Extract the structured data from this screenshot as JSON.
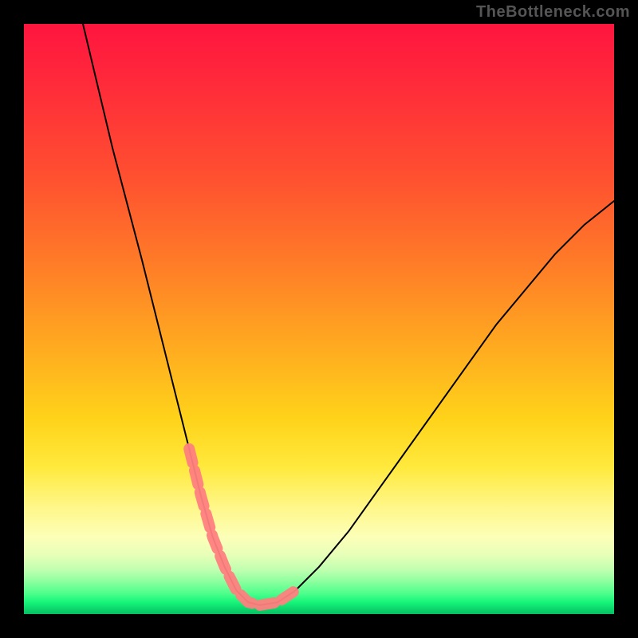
{
  "attribution": "TheBottleneck.com",
  "chart_data": {
    "type": "line",
    "title": "",
    "xlabel": "",
    "ylabel": "",
    "xlim": [
      0,
      100
    ],
    "ylim": [
      0,
      100
    ],
    "grid": false,
    "legend": false,
    "background_gradient": {
      "stops": [
        {
          "pos": 0.0,
          "color": "#ff153f"
        },
        {
          "pos": 0.5,
          "color": "#ffa820"
        },
        {
          "pos": 0.75,
          "color": "#ffe93c"
        },
        {
          "pos": 0.9,
          "color": "#e7ffb8"
        },
        {
          "pos": 1.0,
          "color": "#07c062"
        }
      ]
    },
    "curve": {
      "comment": "Black V-shaped bottleneck curve. y = percentage height from bottom (0=bottom, 100=top).",
      "x": [
        10,
        15,
        20,
        25,
        28,
        30,
        32,
        34,
        36,
        38,
        40,
        43,
        46,
        50,
        55,
        60,
        65,
        70,
        75,
        80,
        85,
        90,
        95,
        100
      ],
      "y": [
        100,
        79,
        60,
        40,
        28,
        20,
        13,
        8,
        4,
        2,
        1.5,
        2,
        4,
        8,
        14,
        21,
        28,
        35,
        42,
        49,
        55,
        61,
        66,
        70
      ]
    },
    "optimal_region_markers": {
      "comment": "Coral markers near the valley bottom indicating the ideal range.",
      "color": "#ff7f7f",
      "x": [
        28,
        30,
        32,
        34,
        36,
        38,
        40,
        43,
        46
      ],
      "y": [
        28,
        20,
        13,
        8,
        4,
        2,
        1.5,
        2,
        4
      ]
    }
  }
}
